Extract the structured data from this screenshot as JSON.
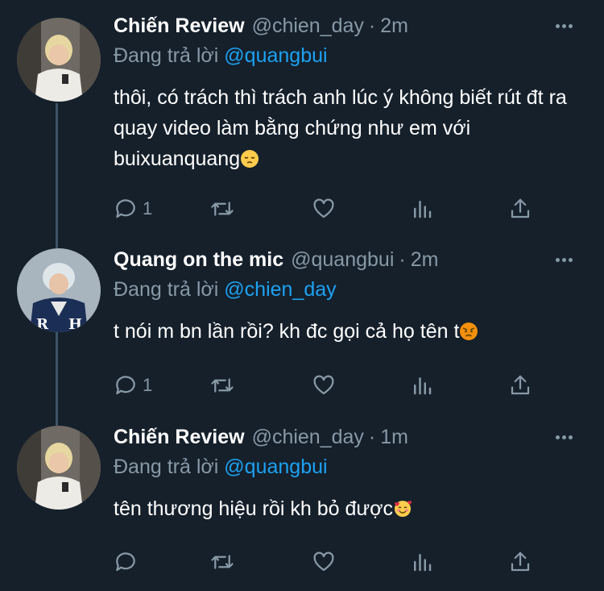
{
  "tweets": [
    {
      "name": "Chiến Review",
      "handle": "@chien_day",
      "dot": "·",
      "time": "2m",
      "reply_prefix": "Đang trả lời",
      "reply_to": "@quangbui",
      "text": "thôi, có trách thì trách anh lúc ý không biết rút đt ra quay video làm bằng chứng như em với buixuanquang",
      "emoji": "pensive-face-emoji",
      "reply_count": "1"
    },
    {
      "name": "Quang on the mic",
      "handle": "@quangbui",
      "dot": "·",
      "time": "2m",
      "reply_prefix": "Đang trả lời",
      "reply_to": "@chien_day",
      "text": "t nói m bn lần rồi? kh đc gọi cả họ tên t",
      "emoji": "angry-face-emoji",
      "reply_count": "1"
    },
    {
      "name": "Chiến Review",
      "handle": "@chien_day",
      "dot": "·",
      "time": "1m",
      "reply_prefix": "Đang trả lời",
      "reply_to": "@quangbui",
      "text": "tên thương hiệu rồi kh bỏ được",
      "emoji": "smiling-face-with-hearts-emoji",
      "reply_count": ""
    }
  ],
  "colors": {
    "background": "#15202b",
    "secondary_text": "#8899a6",
    "mention": "#1da1f2",
    "thread_line": "#3d5466"
  }
}
